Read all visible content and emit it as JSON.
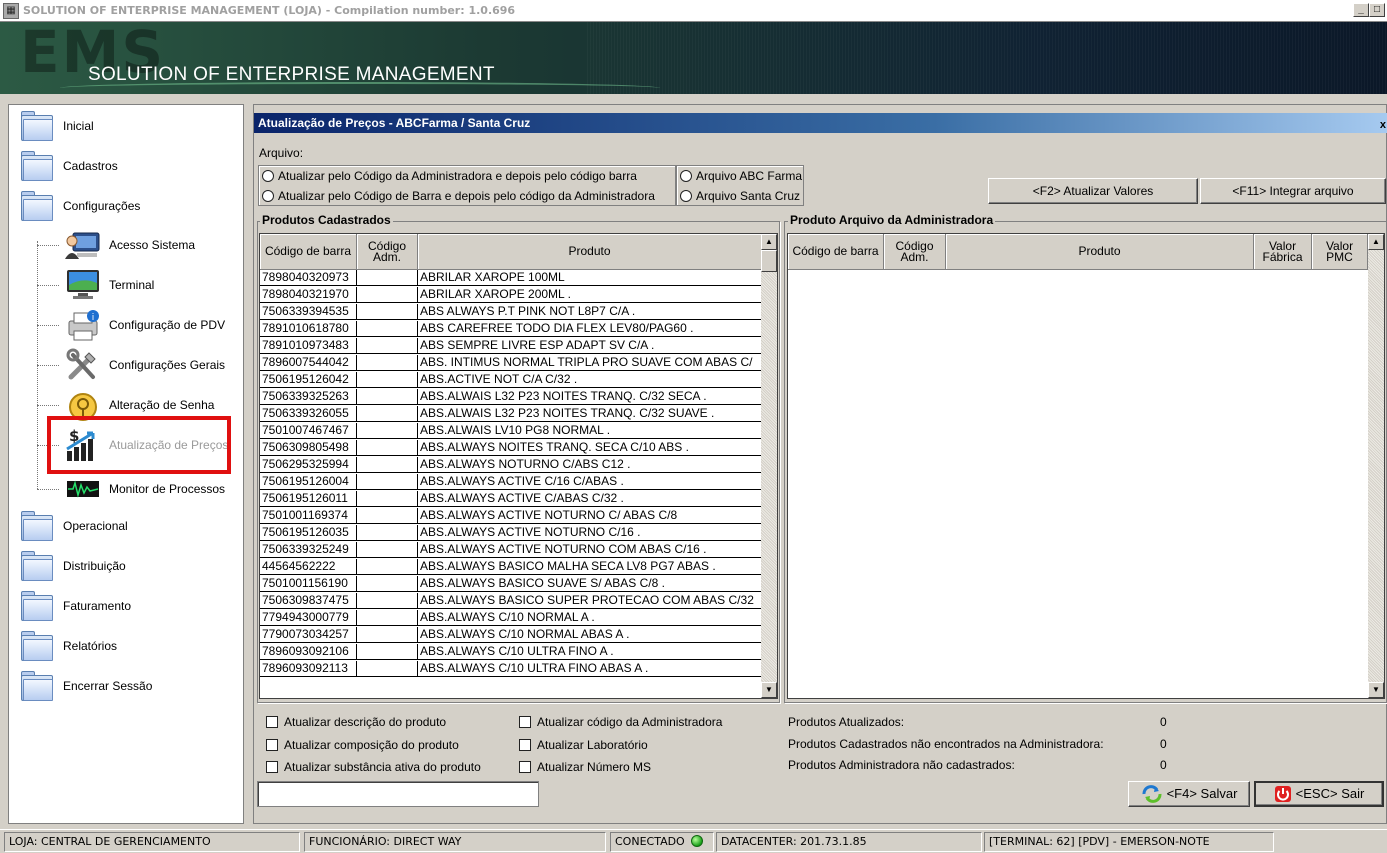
{
  "window": {
    "title": "SOLUTION OF ENTERPRISE MANAGEMENT (LOJA) - Compilation number: 1.0.696",
    "banner_logo": "EMS",
    "banner_title": "SOLUTION OF ENTERPRISE MANAGEMENT",
    "minimize": "_",
    "maximize": "□"
  },
  "sidebar": {
    "top_items": [
      {
        "label": "Inicial",
        "icon": "folder-icon"
      },
      {
        "label": "Cadastros",
        "icon": "folder-icon"
      },
      {
        "label": "Configurações",
        "icon": "folder-icon"
      }
    ],
    "config_children": [
      {
        "label": "Acesso Sistema",
        "icon": "user-computer-icon"
      },
      {
        "label": "Terminal",
        "icon": "monitor-icon"
      },
      {
        "label": "Configuração de PDV",
        "icon": "printer-icon"
      },
      {
        "label": "Configurações Gerais",
        "icon": "tools-icon"
      },
      {
        "label": "Alteração de Senha",
        "icon": "key-icon"
      },
      {
        "label": "Atualização de Preços",
        "icon": "price-chart-icon",
        "selected": true
      },
      {
        "label": "Monitor de Processos",
        "icon": "process-monitor-icon"
      }
    ],
    "bottom_items": [
      {
        "label": "Operacional",
        "icon": "folder-icon"
      },
      {
        "label": "Distribuição",
        "icon": "folder-icon"
      },
      {
        "label": "Faturamento",
        "icon": "folder-icon"
      },
      {
        "label": "Relatórios",
        "icon": "folder-icon"
      },
      {
        "label": "Encerrar Sessão",
        "icon": "folder-icon"
      }
    ]
  },
  "panel": {
    "title": "Atualização de Preços - ABCFarma / Santa Cruz",
    "close": "x",
    "arquivo_label": "Arquivo:",
    "radio_modes": [
      {
        "label": "Atualizar pelo Código da Administradora e depois pelo código barra",
        "checked": false
      },
      {
        "label": "Atualizar pelo Código de Barra e depois pelo código da Administradora",
        "checked": false
      }
    ],
    "radio_files": [
      {
        "label": "Arquivo ABC Farma",
        "checked": false
      },
      {
        "label": "Arquivo Santa Cruz",
        "checked": false
      }
    ],
    "btn_f2": "<F2> Atualizar Valores",
    "btn_f11": "<F11> Integrar arquivo",
    "left_group_title": "Produtos Cadastrados",
    "right_group_title": "Produto Arquivo da Administradora",
    "left_columns": [
      "Código de barra",
      "Código Adm.",
      "Produto"
    ],
    "right_columns": [
      "Código de barra",
      "Código Adm.",
      "Produto",
      "Valor Fábrica",
      "Valor PMC"
    ],
    "rows": [
      {
        "barcode": "7898040320973",
        "adm": "",
        "produto": "ABRILAR XAROPE 100ML"
      },
      {
        "barcode": "7898040321970",
        "adm": "",
        "produto": "ABRILAR XAROPE 200ML ."
      },
      {
        "barcode": "7506339394535",
        "adm": "",
        "produto": "ABS ALWAYS P.T PINK NOT L8P7 C/A ."
      },
      {
        "barcode": "7891010618780",
        "adm": "",
        "produto": "ABS CAREFREE TODO DIA FLEX LEV80/PAG60 ."
      },
      {
        "barcode": "7891010973483",
        "adm": "",
        "produto": "ABS SEMPRE LIVRE ESP ADAPT SV C/A ."
      },
      {
        "barcode": "7896007544042",
        "adm": "",
        "produto": "ABS. INTIMUS NORMAL TRIPLA PRO SUAVE COM ABAS C/"
      },
      {
        "barcode": "7506195126042",
        "adm": "",
        "produto": "ABS.ACTIVE NOT C/A C/32 ."
      },
      {
        "barcode": "7506339325263",
        "adm": "",
        "produto": "ABS.ALWAIS L32 P23 NOITES TRANQ. C/32 SECA ."
      },
      {
        "barcode": "7506339326055",
        "adm": "",
        "produto": "ABS.ALWAIS L32 P23 NOITES TRANQ. C/32 SUAVE ."
      },
      {
        "barcode": "7501007467467",
        "adm": "",
        "produto": "ABS.ALWAIS LV10 PG8 NORMAL ."
      },
      {
        "barcode": "7506309805498",
        "adm": "",
        "produto": "ABS.ALWAYS  NOITES TRANQ. SECA C/10 ABS ."
      },
      {
        "barcode": "7506295325994",
        "adm": "",
        "produto": "ABS.ALWAYS  NOTURNO C/ABS C12 ."
      },
      {
        "barcode": "7506195126004",
        "adm": "",
        "produto": "ABS.ALWAYS ACTIVE C/16 C/ABAS ."
      },
      {
        "barcode": "7506195126011",
        "adm": "",
        "produto": "ABS.ALWAYS ACTIVE C/ABAS C/32 ."
      },
      {
        "barcode": "7501001169374",
        "adm": "",
        "produto": "ABS.ALWAYS ACTIVE NOTURNO C/ ABAS C/8"
      },
      {
        "barcode": "7506195126035",
        "adm": "",
        "produto": "ABS.ALWAYS ACTIVE NOTURNO C/16 ."
      },
      {
        "barcode": "7506339325249",
        "adm": "",
        "produto": "ABS.ALWAYS ACTIVE NOTURNO COM ABAS C/16 ."
      },
      {
        "barcode": "44564562222",
        "adm": "",
        "produto": "ABS.ALWAYS BASICO MALHA SECA LV8 PG7 ABAS ."
      },
      {
        "barcode": "7501001156190",
        "adm": "",
        "produto": "ABS.ALWAYS BASICO SUAVE S/ ABAS C/8 ."
      },
      {
        "barcode": "7506309837475",
        "adm": "",
        "produto": "ABS.ALWAYS BASICO SUPER PROTECAO COM ABAS C/32"
      },
      {
        "barcode": "7794943000779",
        "adm": "",
        "produto": "ABS.ALWAYS C/10 NORMAL A ."
      },
      {
        "barcode": "7790073034257",
        "adm": "",
        "produto": "ABS.ALWAYS C/10 NORMAL ABAS A ."
      },
      {
        "barcode": "7896093092106",
        "adm": "",
        "produto": "ABS.ALWAYS C/10 ULTRA FINO A ."
      },
      {
        "barcode": "7896093092113",
        "adm": "",
        "produto": "ABS.ALWAYS C/10 ULTRA FINO ABAS A ."
      }
    ],
    "checkboxes_left": [
      {
        "label": "Atualizar descrição do produto",
        "checked": false
      },
      {
        "label": "Atualizar composição do produto",
        "checked": false
      },
      {
        "label": "Atualizar substância ativa do produto",
        "checked": false
      }
    ],
    "checkboxes_right": [
      {
        "label": "Atualizar código da Administradora",
        "checked": false
      },
      {
        "label": "Atualizar Laboratório",
        "checked": false
      },
      {
        "label": "Atualizar Número MS",
        "checked": false
      }
    ],
    "stats": [
      {
        "label": "Produtos Atualizados:",
        "value": "0"
      },
      {
        "label": "Produtos Cadastrados não encontrados na Administradora:",
        "value": "0"
      },
      {
        "label": "Produtos Administradora não cadastrados:",
        "value": "0"
      }
    ],
    "filter_value": "",
    "btn_save": "<F4> Salvar",
    "btn_exit": "<ESC> Sair"
  },
  "statusbar": {
    "loja": "LOJA: CENTRAL DE GERENCIAMENTO",
    "funcionario": "FUNCIONÁRIO: DIRECT WAY",
    "conectado": "CONECTADO",
    "datacenter": "DATACENTER: 201.73.1.85",
    "terminal": "[TERMINAL: 62] [PDV] - EMERSON-NOTE"
  },
  "colors": {
    "panel_header": "#0a246a",
    "selection_highlight": "#e01010",
    "connected_led": "#19a019"
  }
}
